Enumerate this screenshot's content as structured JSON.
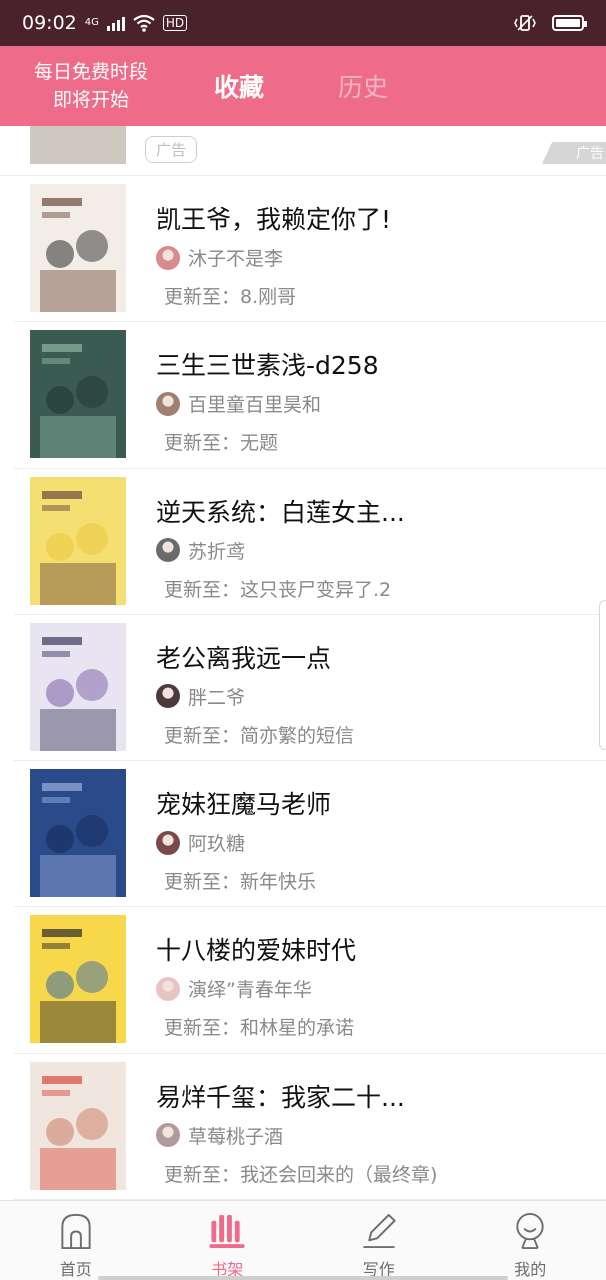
{
  "status_bar": {
    "time": "09:02",
    "network": "4G",
    "hd": "HD"
  },
  "header": {
    "promo_line1": "每日免费时段",
    "promo_line2": "即将开始",
    "tabs": [
      {
        "label": "收藏",
        "active": true
      },
      {
        "label": "历史",
        "active": false
      }
    ]
  },
  "ad": {
    "badge": "广告",
    "corner": "广告"
  },
  "books": [
    {
      "title": "凯王爷，我赖定你了!",
      "author": "沐子不是李",
      "update": "更新至：8.刚哥",
      "cover_palette": [
        "#f2ede6",
        "#2b2b2b",
        "#6b4a3a"
      ],
      "avatar_color": "#d98a8a"
    },
    {
      "title": "三生三世素浅-d258",
      "author": "百里童百里昊和",
      "update": "更新至：无题",
      "cover_palette": [
        "#3a5a52",
        "#1e3530",
        "#8fb5a5"
      ],
      "avatar_color": "#a08070"
    },
    {
      "title": "逆天系统：白莲女主...",
      "author": "苏折鸢",
      "update": "更新至：这只丧尸变异了.2",
      "cover_palette": [
        "#f6df72",
        "#e9c63b",
        "#6b4a3a"
      ],
      "avatar_color": "#6b6b6b"
    },
    {
      "title": "老公离我远一点",
      "author": "胖二爷",
      "update": "更新至：简亦繁的短信",
      "cover_palette": [
        "#e9e4f2",
        "#7a5fa3",
        "#3b3b5a"
      ],
      "avatar_color": "#4a3a3a"
    },
    {
      "title": "宠妹狂魔马老师",
      "author": "阿玖糖",
      "update": "更新至：新年快乐",
      "cover_palette": [
        "#2a4a8a",
        "#132a5a",
        "#9ab0dd"
      ],
      "avatar_color": "#7a4a4a"
    },
    {
      "title": "十八楼的爱妹时代",
      "author": "演绎”青春年华",
      "update": "更新至：和林星的承诺",
      "cover_palette": [
        "#f7d84a",
        "#3a6aa8",
        "#2b2b2b"
      ],
      "avatar_color": "#e6c4c4"
    },
    {
      "title": "易烊千玺：我家二十...",
      "author": "草莓桃子酒",
      "update": "更新至：我还会回来的（最终章)",
      "cover_palette": [
        "#f1e6df",
        "#c97a63",
        "#d94a3a"
      ],
      "avatar_color": "#b09a9a"
    }
  ],
  "bottom_nav": [
    {
      "label": "首页",
      "icon": "home-icon",
      "active": false
    },
    {
      "label": "书架",
      "icon": "bookshelf-icon",
      "active": true
    },
    {
      "label": "写作",
      "icon": "pen-icon",
      "active": false
    },
    {
      "label": "我的",
      "icon": "profile-icon",
      "active": false
    }
  ],
  "colors": {
    "brand": "#ee6c89",
    "status_bar": "#4a222c"
  }
}
